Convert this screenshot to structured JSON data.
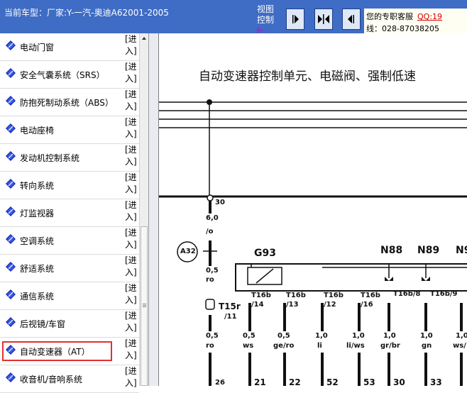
{
  "header": {
    "model_label": "当前车型：厂家:Y-一汽-奥迪A62001-2005",
    "view_control": "视图控制",
    "service_label": "您的专职客服",
    "qq": "QQ:19",
    "hotline": "线：028-87038205"
  },
  "sidebar": {
    "enter_label": "[进入]",
    "items": [
      {
        "label": "电动门窗"
      },
      {
        "label": "安全气囊系统（SRS）"
      },
      {
        "label": "防抱死制动系统（ABS）"
      },
      {
        "label": "电动座椅"
      },
      {
        "label": "发动机控制系统"
      },
      {
        "label": "转向系统"
      },
      {
        "label": "灯监视器"
      },
      {
        "label": "空调系统"
      },
      {
        "label": "舒适系统"
      },
      {
        "label": "通信系统"
      },
      {
        "label": "后视镜/车窗"
      },
      {
        "label": "自动变速器（AT）"
      },
      {
        "label": "收音机/音响系统"
      }
    ],
    "active_item": "自动变速器（AT）"
  },
  "diagram": {
    "title": "自动变速器控制单元、电磁阀、强制低速",
    "labels": {
      "n30": "30",
      "w60": "6,0",
      "wro": "/o",
      "a32": "A32",
      "w05a": "0,5",
      "wroa": "ro",
      "t15": "T15r",
      "t15b": "/11",
      "g93": "G93",
      "n88": "N88",
      "n89": "N89",
      "n9x": "N9",
      "t16a": "T16b",
      "t16a2": "/14",
      "t16b": "T16b",
      "t16b2": "/13",
      "t16c": "T16b",
      "t16c2": "/12",
      "t16d": "T16b",
      "t16d2": "/16",
      "t16e": "T16b/8",
      "t16f": "T16b/9",
      "s1v": "0,5",
      "s1c": "ro",
      "s2v": "0,5",
      "s2c": "ws",
      "s3v": "0,5",
      "s3c": "ge/ro",
      "s4v": "1,0",
      "s4c": "li",
      "s5v": "1,0",
      "s5c": "li/ws",
      "s6v": "1,0",
      "s6c": "gr/br",
      "s7v": "1,0",
      "s7c": "gn",
      "s8v": "1,0",
      "s8c": "ws/",
      "e1": "26",
      "e2": "21",
      "e3": "22",
      "e4": "52",
      "e5": "53",
      "e6": "30",
      "e7": "33"
    }
  }
}
